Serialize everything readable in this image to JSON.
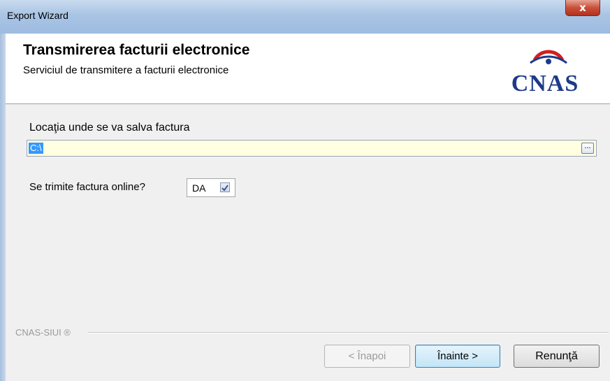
{
  "window": {
    "title": "Export Wizard",
    "close_glyph": "x",
    "close_icon": "close-icon"
  },
  "header": {
    "title": "Transmirerea facturii electronice",
    "subtitle": "Serviciul de transmitere a facturii electronice",
    "logo_text": "CNAS",
    "logo_colors": {
      "text": "#1d3a8a",
      "accent": "#d21f1f"
    }
  },
  "location": {
    "label": "Locaţia unde se va salva factura",
    "value": "C:\\",
    "browse_label": "..."
  },
  "online": {
    "label": "Se trimite factura online?",
    "option_text": "DA",
    "checked": true
  },
  "footer": {
    "brand": "CNAS-SIUI ®",
    "back_label": "< Înapoi",
    "next_label": "Înainte >",
    "cancel_label": "Renunţă"
  }
}
